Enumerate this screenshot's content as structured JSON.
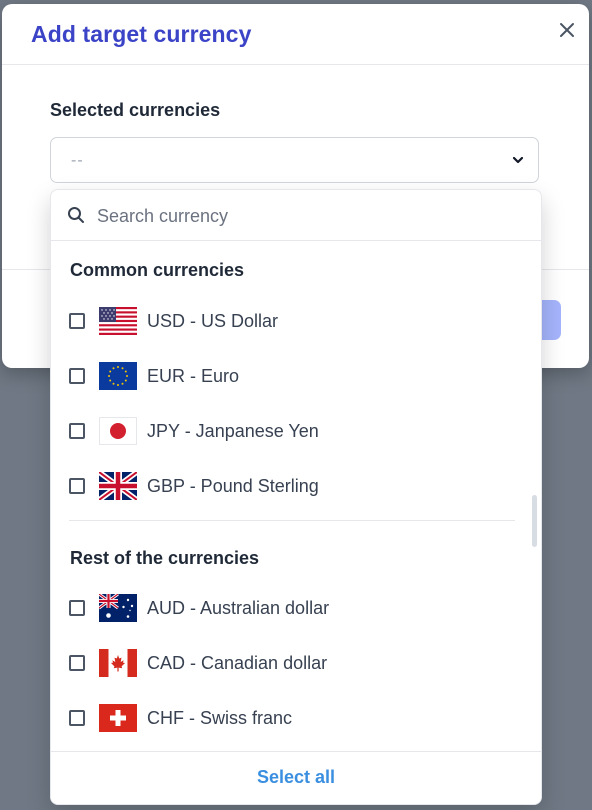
{
  "modal": {
    "title": "Add target currency",
    "field_label": "Selected currencies",
    "select_value": "--"
  },
  "dropdown": {
    "search_placeholder": "Search currency",
    "common_title": "Common currencies",
    "common": [
      {
        "label": "USD - US Dollar",
        "flag": "us-flag-icon",
        "checked": false
      },
      {
        "label": "EUR - Euro",
        "flag": "eu-flag-icon",
        "checked": false
      },
      {
        "label": "JPY - Janpanese Yen",
        "flag": "jp-flag-icon",
        "checked": false
      },
      {
        "label": "GBP - Pound Sterling",
        "flag": "gb-flag-icon",
        "checked": false
      }
    ],
    "rest_title": "Rest of the currencies",
    "rest": [
      {
        "label": "AUD - Australian dollar",
        "flag": "au-flag-icon",
        "checked": false
      },
      {
        "label": "CAD - Canadian dollar",
        "flag": "ca-flag-icon",
        "checked": false
      },
      {
        "label": "CHF - Swiss franc",
        "flag": "ch-flag-icon",
        "checked": false
      }
    ],
    "select_all": "Select all"
  },
  "colors": {
    "accent_title": "#3b43c7",
    "link": "#3b8fe0",
    "primary_disabled": "#a5b4fc",
    "overlay": "#6f7884"
  }
}
